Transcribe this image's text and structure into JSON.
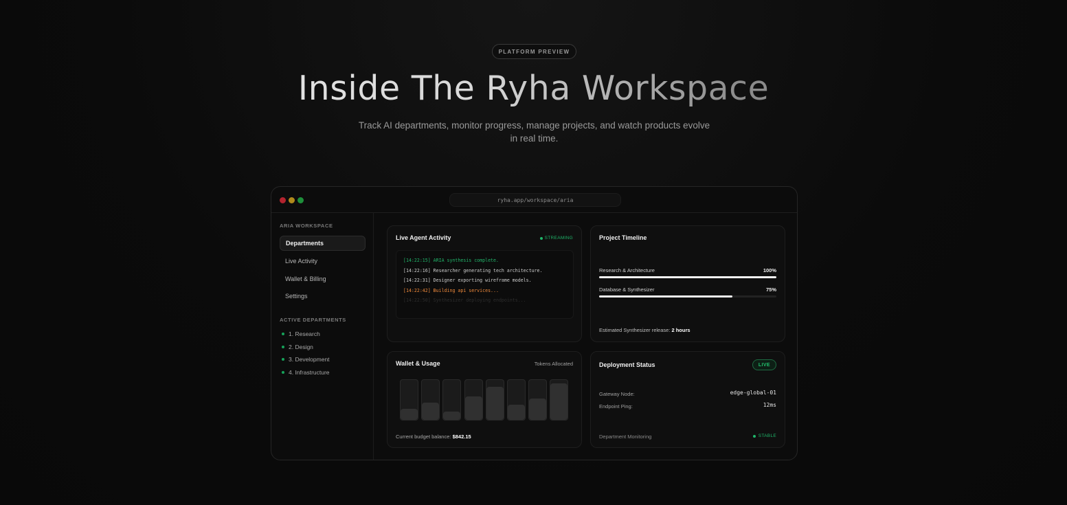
{
  "hero": {
    "badge": "PLATFORM PREVIEW",
    "title": "Inside The Ryha Workspace",
    "subtitle": "Track AI departments, monitor progress, manage projects, and watch products evolve in real time."
  },
  "window": {
    "url": "ryha.app/workspace/aria"
  },
  "sidebar": {
    "heading": "ARIA WORKSPACE",
    "nav": [
      {
        "label": "Departments",
        "active": true
      },
      {
        "label": "Live Activity",
        "active": false
      },
      {
        "label": "Wallet & Billing",
        "active": false
      },
      {
        "label": "Settings",
        "active": false
      }
    ],
    "departments_heading": "ACTIVE DEPARTMENTS",
    "departments": [
      "1. Research",
      "2. Design",
      "3. Development",
      "4. Infrastructure"
    ]
  },
  "activity": {
    "title": "Live Agent Activity",
    "badge": "STREAMING",
    "logs": [
      {
        "text": "[14:22:15] ARIA synthesis complete.",
        "color": "#22b56b"
      },
      {
        "text": "[14:22:16] Researcher generating tech architecture.",
        "color": "#cfcfcf"
      },
      {
        "text": "[14:22:31] Designer exporting wireframe models.",
        "color": "#cfcfcf"
      },
      {
        "text": "[14:22:42] Building api services...",
        "color": "#f08a3c"
      },
      {
        "text": "[14:22:50] Synthesizer deploying endpoints...",
        "color": "#2e2e2e"
      }
    ]
  },
  "timeline": {
    "title": "Project Timeline",
    "items": [
      {
        "label": "Research & Architecture",
        "pct_label": "100%",
        "progress": 1.0
      },
      {
        "label": "Database & Synthesizer",
        "pct_label": "75%",
        "progress": 0.75
      }
    ],
    "footer_prefix": "Estimated Synthesizer release: ",
    "footer_value": "2 hours"
  },
  "wallet": {
    "title": "Wallet & Usage",
    "tokens_label": "Tokens Allocated",
    "bars": [
      0.28,
      0.43,
      0.2,
      0.58,
      0.82,
      0.38,
      0.53,
      0.92
    ],
    "budget_prefix": "Current budget balance: ",
    "budget_value": "$842.15"
  },
  "deployment": {
    "title": "Deployment Status",
    "badge": "LIVE",
    "gateway_label": "Gateway Node:",
    "gateway_value": "edge-global-01",
    "ping_label": "Endpoint Ping:",
    "ping_value": "12ms",
    "monitor_label": "Department Monitoring",
    "monitor_status": "STABLE"
  },
  "colors": {
    "accent_green": "#1fb56a",
    "warning_orange": "#f08a3c"
  }
}
